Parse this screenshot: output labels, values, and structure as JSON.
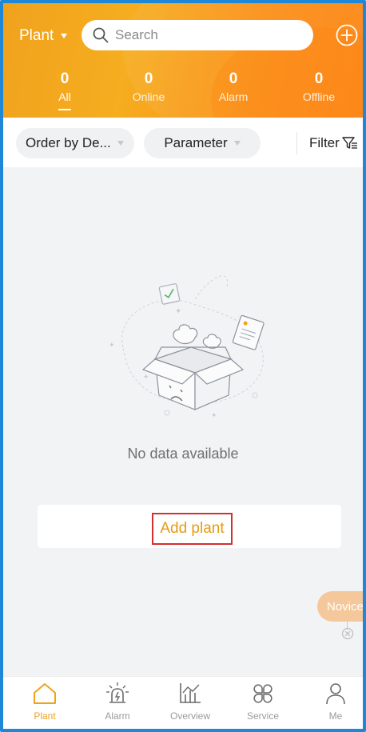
{
  "header": {
    "plant_dropdown": "Plant",
    "search_placeholder": "Search",
    "stats": [
      {
        "count": "0",
        "label": "All"
      },
      {
        "count": "0",
        "label": "Online"
      },
      {
        "count": "0",
        "label": "Alarm"
      },
      {
        "count": "0",
        "label": "Offline"
      }
    ]
  },
  "filters": {
    "order_label": "Order by De...",
    "parameter_label": "Parameter",
    "filter_label": "Filter"
  },
  "empty": {
    "message": "No data available",
    "add_plant_label": "Add plant"
  },
  "novice": {
    "label": "Novice"
  },
  "tabs": [
    {
      "label": "Plant",
      "icon": "home-icon"
    },
    {
      "label": "Alarm",
      "icon": "siren-icon"
    },
    {
      "label": "Overview",
      "icon": "chart-icon"
    },
    {
      "label": "Service",
      "icon": "service-icon"
    },
    {
      "label": "Me",
      "icon": "user-icon"
    }
  ],
  "colors": {
    "accent": "#f0a21d",
    "header_end": "#fd8412",
    "highlight_border": "#d32f2f",
    "frame_border": "#1e88d6"
  }
}
